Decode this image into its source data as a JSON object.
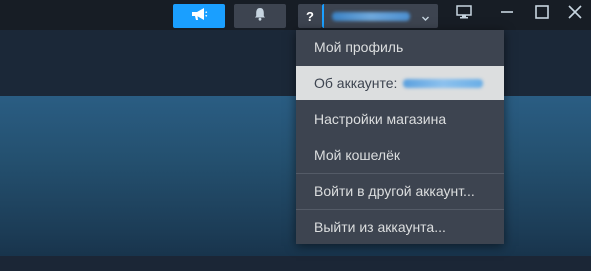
{
  "topbar": {
    "help_label": "?",
    "account_name_blurred": true
  },
  "icons": {
    "announce": "megaphone-icon",
    "notifications": "bell-icon",
    "account_dropdown": "chevron-down-icon",
    "big_picture": "monitor-icon",
    "minimize": "minimize-icon",
    "maximize": "maximize-icon",
    "close": "close-icon"
  },
  "colors": {
    "accent": "#1a9fff",
    "menu_bg": "#3d4450",
    "menu_text": "#dcdedf",
    "menu_hover_bg": "#dcdedf"
  },
  "account_menu": {
    "items": [
      {
        "label": "Мой профиль"
      },
      {
        "label": "Об аккаунте:",
        "value_blurred": true,
        "highlighted": true
      },
      {
        "label": "Настройки магазина"
      },
      {
        "label": "Мой кошелёк"
      },
      {
        "label": "Войти в другой аккаунт..."
      },
      {
        "label": "Выйти из аккаунта..."
      }
    ]
  }
}
